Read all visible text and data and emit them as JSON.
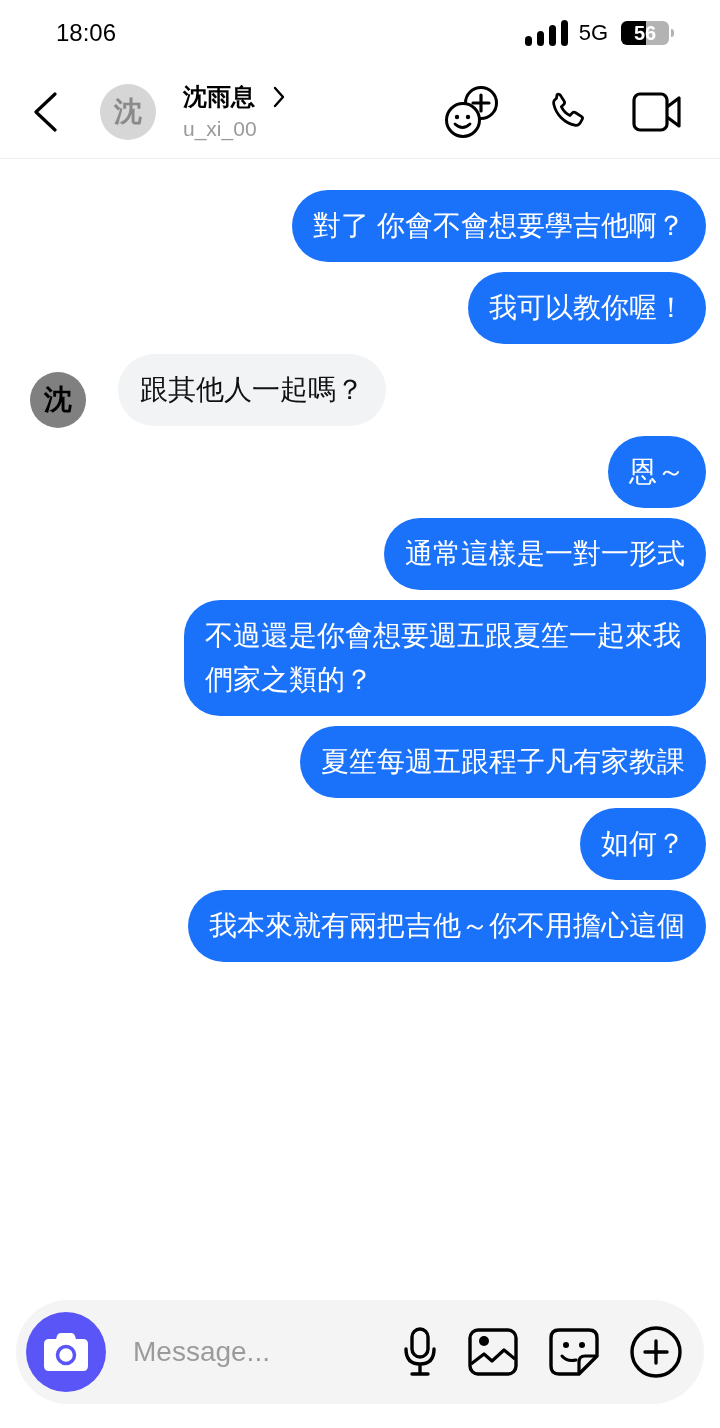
{
  "status_bar": {
    "time": "18:06",
    "network": "5G",
    "battery": "56"
  },
  "header": {
    "avatar": "沈",
    "name": "沈雨息",
    "username": "u_xi_00"
  },
  "messages": [
    {
      "kind": "sent",
      "text": "對了 你會不會想要學吉他啊？"
    },
    {
      "kind": "sent",
      "text": "我可以教你喔！"
    },
    {
      "kind": "received",
      "avatar": "沈",
      "text": "跟其他人一起嗎？"
    },
    {
      "kind": "sent",
      "text": "恩～"
    },
    {
      "kind": "sent",
      "text": "通常這樣是一對一形式"
    },
    {
      "kind": "sent",
      "text": "不過還是你會想要週五跟夏笙一起來我們家之類的？"
    },
    {
      "kind": "sent",
      "text": "夏笙每週五跟程子凡有家教課"
    },
    {
      "kind": "sent",
      "text": "如何？"
    },
    {
      "kind": "sent",
      "text": "我本來就有兩把吉他～你不用擔心這個"
    }
  ],
  "composer": {
    "placeholder": "Message..."
  }
}
